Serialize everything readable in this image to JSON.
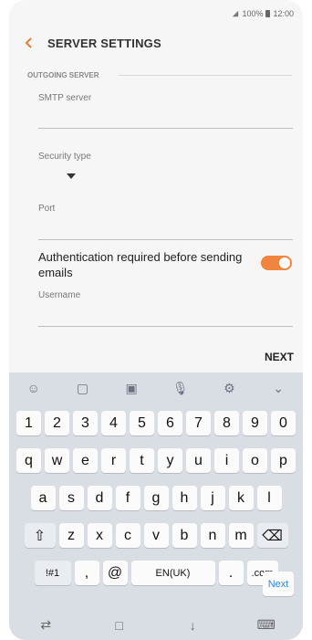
{
  "status": {
    "signal_label": "⅃",
    "battery_text": "100%",
    "time": "12:00"
  },
  "appbar": {
    "title": "SERVER SETTINGS"
  },
  "form": {
    "section_title": "OUTGOING SERVER",
    "smtp_label": "SMTP server",
    "security_label": "Security type",
    "port_label": "Port",
    "auth_label": "Authentication required before sending emails",
    "username_label": "Username",
    "toggle_on": true,
    "accent_color": "#f1843f"
  },
  "actions": {
    "next_label": "NEXT"
  },
  "keyboard": {
    "toolbar_icons": [
      "emoji-icon",
      "sticker-icon",
      "gif-icon",
      "mic-icon",
      "settings-icon",
      "chevron-down-icon"
    ],
    "row_numbers": [
      "1",
      "2",
      "3",
      "4",
      "5",
      "6",
      "7",
      "8",
      "9",
      "0"
    ],
    "row_qwerty": [
      "q",
      "w",
      "e",
      "r",
      "t",
      "y",
      "u",
      "i",
      "o",
      "p"
    ],
    "row_asdf": [
      "a",
      "s",
      "d",
      "f",
      "g",
      "h",
      "j",
      "k",
      "l"
    ],
    "row_zxcv": [
      "z",
      "x",
      "c",
      "v",
      "b",
      "n",
      "m"
    ],
    "bottom": {
      "symbols": "!#1",
      "comma": ",",
      "at": "@",
      "space": "EN(UK)",
      "period": ".",
      "com": ".com",
      "next": "Next"
    }
  },
  "navbar": {
    "icons": [
      "recent-apps-icon",
      "home-icon",
      "back-icon",
      "keyboard-icon"
    ]
  }
}
